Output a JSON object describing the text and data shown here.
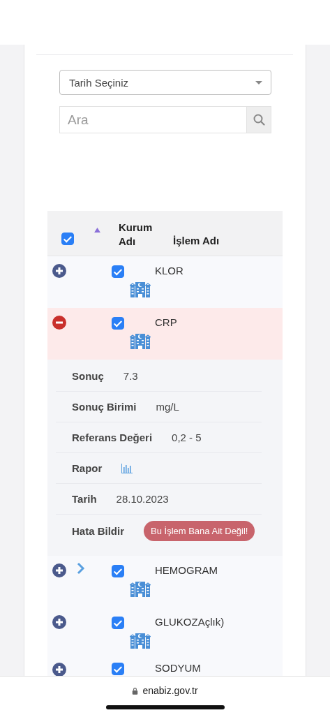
{
  "filters": {
    "date_select": {
      "value": "Tarih Seçiniz"
    },
    "search": {
      "placeholder": "Ara"
    }
  },
  "table": {
    "select_all": {
      "checked": true
    },
    "columns": [
      {
        "label": "Kurum Adı",
        "sorted": true
      },
      {
        "label": "İşlem Adı",
        "sorted": false
      }
    ],
    "rows": [
      {
        "name": "KLOR",
        "checked": true,
        "expanded": false,
        "chevron": false
      },
      {
        "name": "CRP",
        "checked": true,
        "expanded": true,
        "chevron": false,
        "details": [
          {
            "kind": "text",
            "label": "Sonuç",
            "value": "7.3"
          },
          {
            "kind": "text",
            "label": "Sonuç Birimi",
            "value": "mg/L"
          },
          {
            "kind": "text",
            "label": "Referans Değeri",
            "value": "0,2 - 5"
          },
          {
            "kind": "icon",
            "label": "Rapor"
          },
          {
            "kind": "text",
            "label": "Tarih",
            "value": "28.10.2023"
          },
          {
            "kind": "button",
            "label": "Hata Bildir",
            "value": "Bu İşlem Bana Ait Değil!"
          }
        ]
      },
      {
        "name": "HEMOGRAM",
        "checked": true,
        "expanded": false,
        "chevron": true
      },
      {
        "name": "GLUKOZAçlık)",
        "checked": true,
        "expanded": false,
        "chevron": false
      },
      {
        "name": "SODYUM",
        "checked": true,
        "expanded": false,
        "chevron": false
      }
    ]
  },
  "browser_bar": {
    "url": "enabiz.gov.tr"
  }
}
